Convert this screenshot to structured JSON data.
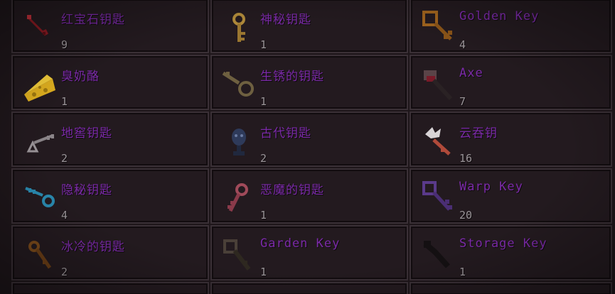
{
  "inventory": {
    "slots": [
      {
        "name": "红宝石钥匙",
        "count": "9",
        "icon": "ruby-key-icon"
      },
      {
        "name": "神秘钥匙",
        "count": "1",
        "icon": "mysterious-key-icon"
      },
      {
        "name": "Golden Key",
        "count": "4",
        "icon": "golden-key-icon"
      },
      {
        "name": "臭奶酪",
        "count": "1",
        "icon": "cheese-icon"
      },
      {
        "name": "生锈的钥匙",
        "count": "1",
        "icon": "rusty-key-icon"
      },
      {
        "name": "Axe",
        "count": "7",
        "icon": "axe-icon"
      },
      {
        "name": "地窖钥匙",
        "count": "2",
        "icon": "cellar-key-icon"
      },
      {
        "name": "古代钥匙",
        "count": "2",
        "icon": "ancient-key-icon"
      },
      {
        "name": "云吞钥",
        "count": "16",
        "icon": "cloud-key-icon"
      },
      {
        "name": "隐秘钥匙",
        "count": "4",
        "icon": "hidden-key-icon"
      },
      {
        "name": "恶魔的钥匙",
        "count": "1",
        "icon": "demon-key-icon"
      },
      {
        "name": "Warp Key",
        "count": "20",
        "icon": "warp-key-icon"
      },
      {
        "name": "冰冷的钥匙",
        "count": "2",
        "icon": "cold-key-icon"
      },
      {
        "name": "Garden Key",
        "count": "1",
        "icon": "garden-key-icon"
      },
      {
        "name": "Storage Key",
        "count": "1",
        "icon": "storage-key-icon"
      }
    ]
  },
  "colors": {
    "item_name": "#7b2aa8",
    "item_count": "#9a9498",
    "slot_border": "#3a3036",
    "background": "#1e161a"
  }
}
